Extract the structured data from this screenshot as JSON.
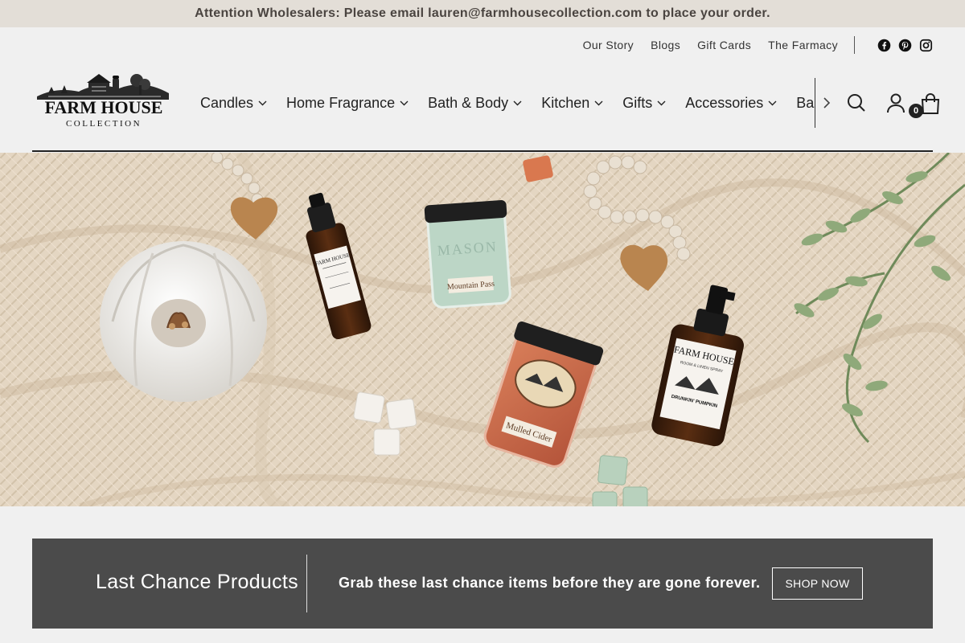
{
  "announcement": "Attention Wholesalers: Please email lauren@farmhousecollection.com to place your order.",
  "utility_links": [
    "Our Story",
    "Blogs",
    "Gift Cards",
    "The Farmacy"
  ],
  "social_icons": [
    "facebook-icon",
    "pinterest-icon",
    "instagram-icon"
  ],
  "logo": {
    "line1": "FARM HOUSE",
    "line2": "COLLECTION"
  },
  "nav": {
    "items": [
      "Candles",
      "Home Fragrance",
      "Bath & Body",
      "Kitchen",
      "Gifts",
      "Accessories",
      "Baby & Kids"
    ]
  },
  "header_icons": [
    "search-icon",
    "account-icon",
    "bag-icon",
    "chevron-right-icon"
  ],
  "cart": {
    "count": "0"
  },
  "hero": {
    "jar_label_mint": "Mountain Pass",
    "jar_label_mint_top": "MASON",
    "jar_label_orange": "Mulled Cider",
    "bottle_label_1": "FARM HOUSE",
    "bottle_label_2": "FARM HOUSE",
    "bottle_sub_2": "ROOM & LINEN SPRAY",
    "bottle_scent_2": "DRUNKIN' PUMPKIN"
  },
  "promo": {
    "title": "Last Chance Products",
    "text": "Grab these last chance items before they are gone forever.",
    "button": "SHOP NOW"
  },
  "colors": {
    "announcement_bg": "#e3ded7",
    "page_bg": "#f0f0f0",
    "promo_bg": "#4b4b4b"
  }
}
